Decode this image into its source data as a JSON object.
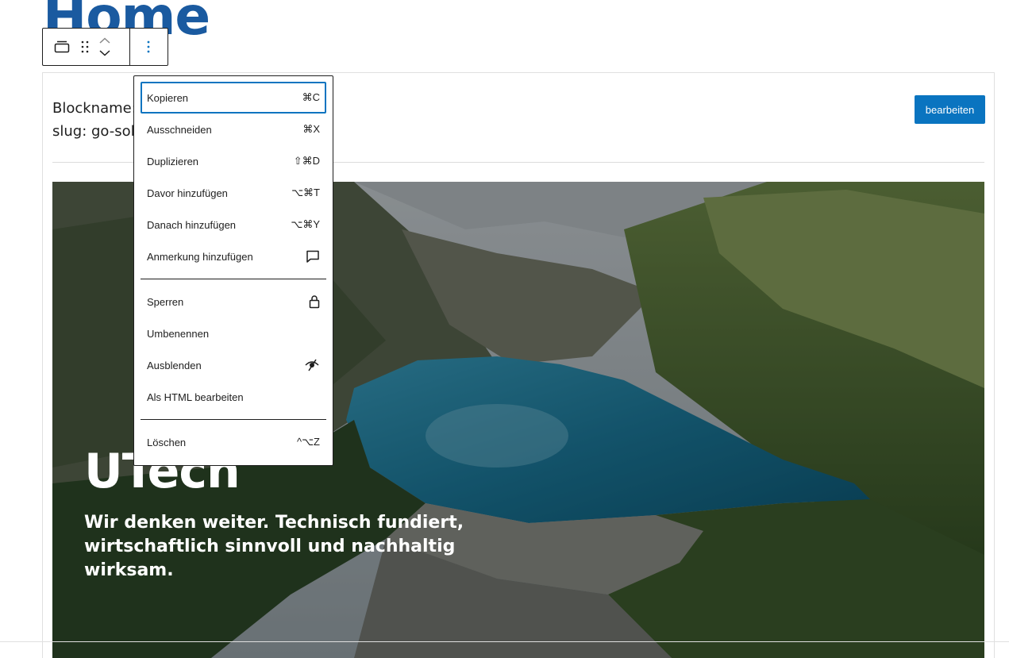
{
  "page": {
    "title": "Home"
  },
  "pattern": {
    "meta_line1": "Blockname: ",
    "meta_line2": "slug: go-solu",
    "edit_label": "bearbeiten"
  },
  "hero": {
    "title": "UTech",
    "text": "Wir denken weiter. Technisch fundiert, wirtschaftlich sinnvoll und nachhaltig wirksam."
  },
  "menu": {
    "groups": [
      [
        {
          "label": "Kopieren",
          "shortcut": "⌘C"
        },
        {
          "label": "Ausschneiden",
          "shortcut": "⌘X"
        },
        {
          "label": "Duplizieren",
          "shortcut": "⇧⌘D"
        },
        {
          "label": "Davor hinzufügen",
          "shortcut": "⌥⌘T"
        },
        {
          "label": "Danach hinzufügen",
          "shortcut": "⌥⌘Y"
        },
        {
          "label": "Anmerkung hinzufügen",
          "icon": "comment-icon"
        }
      ],
      [
        {
          "label": "Sperren",
          "icon": "lock-icon"
        },
        {
          "label": "Umbenennen"
        },
        {
          "label": "Ausblenden",
          "icon": "hidden-icon"
        },
        {
          "label": "Als HTML bearbeiten"
        }
      ],
      [
        {
          "label": "Löschen",
          "shortcut": "^⌥Z"
        }
      ]
    ]
  },
  "colors": {
    "accent": "#0a74c0",
    "title": "#1a5aa0"
  }
}
